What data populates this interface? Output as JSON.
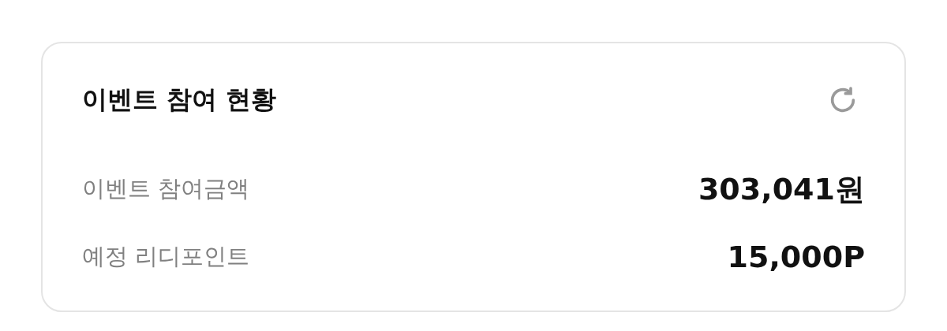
{
  "card": {
    "title": "이벤트 참여 현황",
    "rows": [
      {
        "label": "이벤트 참여금액",
        "value": "303,041원"
      },
      {
        "label": "예정 리디포인트",
        "value": "15,000P"
      }
    ]
  }
}
